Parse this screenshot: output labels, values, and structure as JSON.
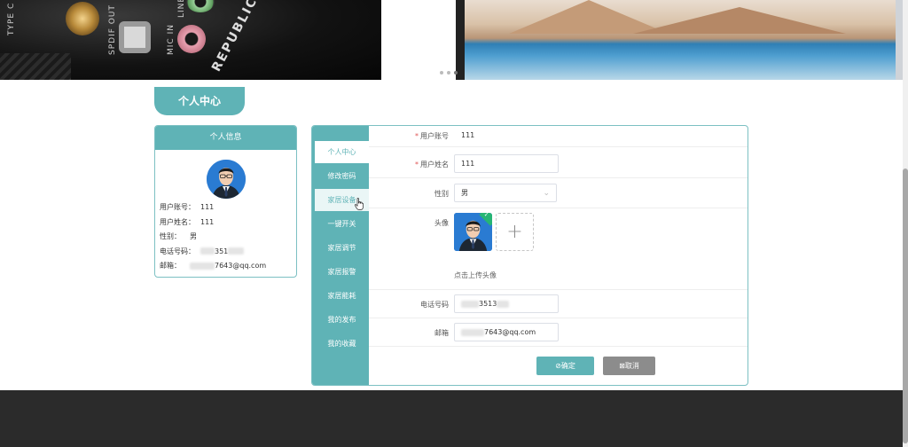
{
  "banner": {
    "left_texts": [
      "TYPE C",
      "SPDIF OUT",
      "MIC IN",
      "LINE",
      "REPUBLIC OF"
    ],
    "carousel_dot_icons": [
      "carousel-dot",
      "carousel-dot",
      "carousel-dot"
    ]
  },
  "section": {
    "title": "个人中心"
  },
  "info_card": {
    "header": "个人信息",
    "rows": [
      {
        "key": "用户账号：",
        "value": "111"
      },
      {
        "key": "用户姓名：",
        "value": "111"
      },
      {
        "key": "性别：",
        "value": "男"
      },
      {
        "key": "电话号码：",
        "value": "351"
      },
      {
        "key": "邮箱：",
        "value": "7643@qq.com"
      }
    ]
  },
  "side_menu": {
    "items": [
      {
        "label": "个人中心",
        "state": "active"
      },
      {
        "label": "修改密码",
        "state": "normal"
      },
      {
        "label": "家居设备",
        "state": "hover"
      },
      {
        "label": "一键开关",
        "state": "normal"
      },
      {
        "label": "家居调节",
        "state": "normal"
      },
      {
        "label": "家居报警",
        "state": "normal"
      },
      {
        "label": "家居能耗",
        "state": "normal"
      },
      {
        "label": "我的发布",
        "state": "normal"
      },
      {
        "label": "我的收藏",
        "state": "normal"
      }
    ]
  },
  "form": {
    "account": {
      "label": "用户账号",
      "required": "*",
      "value": "111"
    },
    "name": {
      "label": "用户姓名",
      "required": "*",
      "value": "111"
    },
    "gender": {
      "label": "性别",
      "value": "男"
    },
    "avatar": {
      "label": "头像",
      "upload_tip": "点击上传头像",
      "upload_icon": "plus-icon"
    },
    "phone": {
      "label": "电话号码",
      "value": "3513"
    },
    "email": {
      "label": "邮箱",
      "value": "7643@qq.com"
    },
    "confirm_label": "⊘确定",
    "cancel_label": "⊠取消"
  },
  "colors": {
    "accent": "#5fb3b6",
    "cancel": "#8c8c8c",
    "required": "#e05555",
    "footer": "#2b2b2b"
  }
}
